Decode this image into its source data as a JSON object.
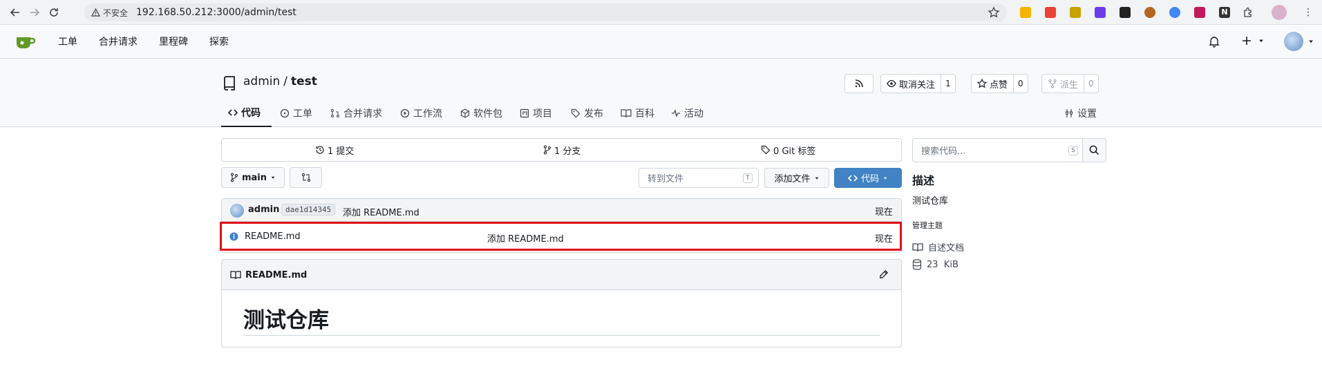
{
  "browser": {
    "insecure_label": "不安全",
    "url": "192.168.50.212:3000/admin/test"
  },
  "navbar": {
    "items": [
      "工单",
      "合并请求",
      "里程碑",
      "探索"
    ]
  },
  "repo": {
    "owner": "admin",
    "separator": "/",
    "name": "test",
    "unwatch_label": "取消关注",
    "watch_count": "1",
    "star_label": "点赞",
    "star_count": "0",
    "fork_label": "派生",
    "fork_count": "0"
  },
  "tabs": [
    "代码",
    "工单",
    "合并请求",
    "工作流",
    "软件包",
    "项目",
    "发布",
    "百科",
    "活动"
  ],
  "settings_label": "设置",
  "stats": {
    "commits": "1 提交",
    "branches": "1 分支",
    "tags": "0 Git 标签"
  },
  "toolbar": {
    "branch": "main",
    "goto_file_placeholder": "转到文件",
    "goto_file_key": "T",
    "add_file": "添加文件",
    "code": "代码"
  },
  "latest_commit": {
    "author": "admin",
    "sha": "dae1d14345",
    "message": "添加 README.md",
    "time": "现在"
  },
  "files": [
    {
      "name": "README.md",
      "message": "添加 README.md",
      "time": "现在"
    }
  ],
  "readme": {
    "filename": "README.md",
    "heading": "测试仓库"
  },
  "sidebar": {
    "search_placeholder": "搜索代码...",
    "search_key": "S",
    "about_title": "描述",
    "description": "测试仓库",
    "topics_label": "管理主题",
    "readme_link": "自述文档",
    "size": "23  KiB"
  },
  "colors": {
    "primary": "#4183c4",
    "highlight_border": "#e0101b",
    "gitea_green": "#609926"
  }
}
